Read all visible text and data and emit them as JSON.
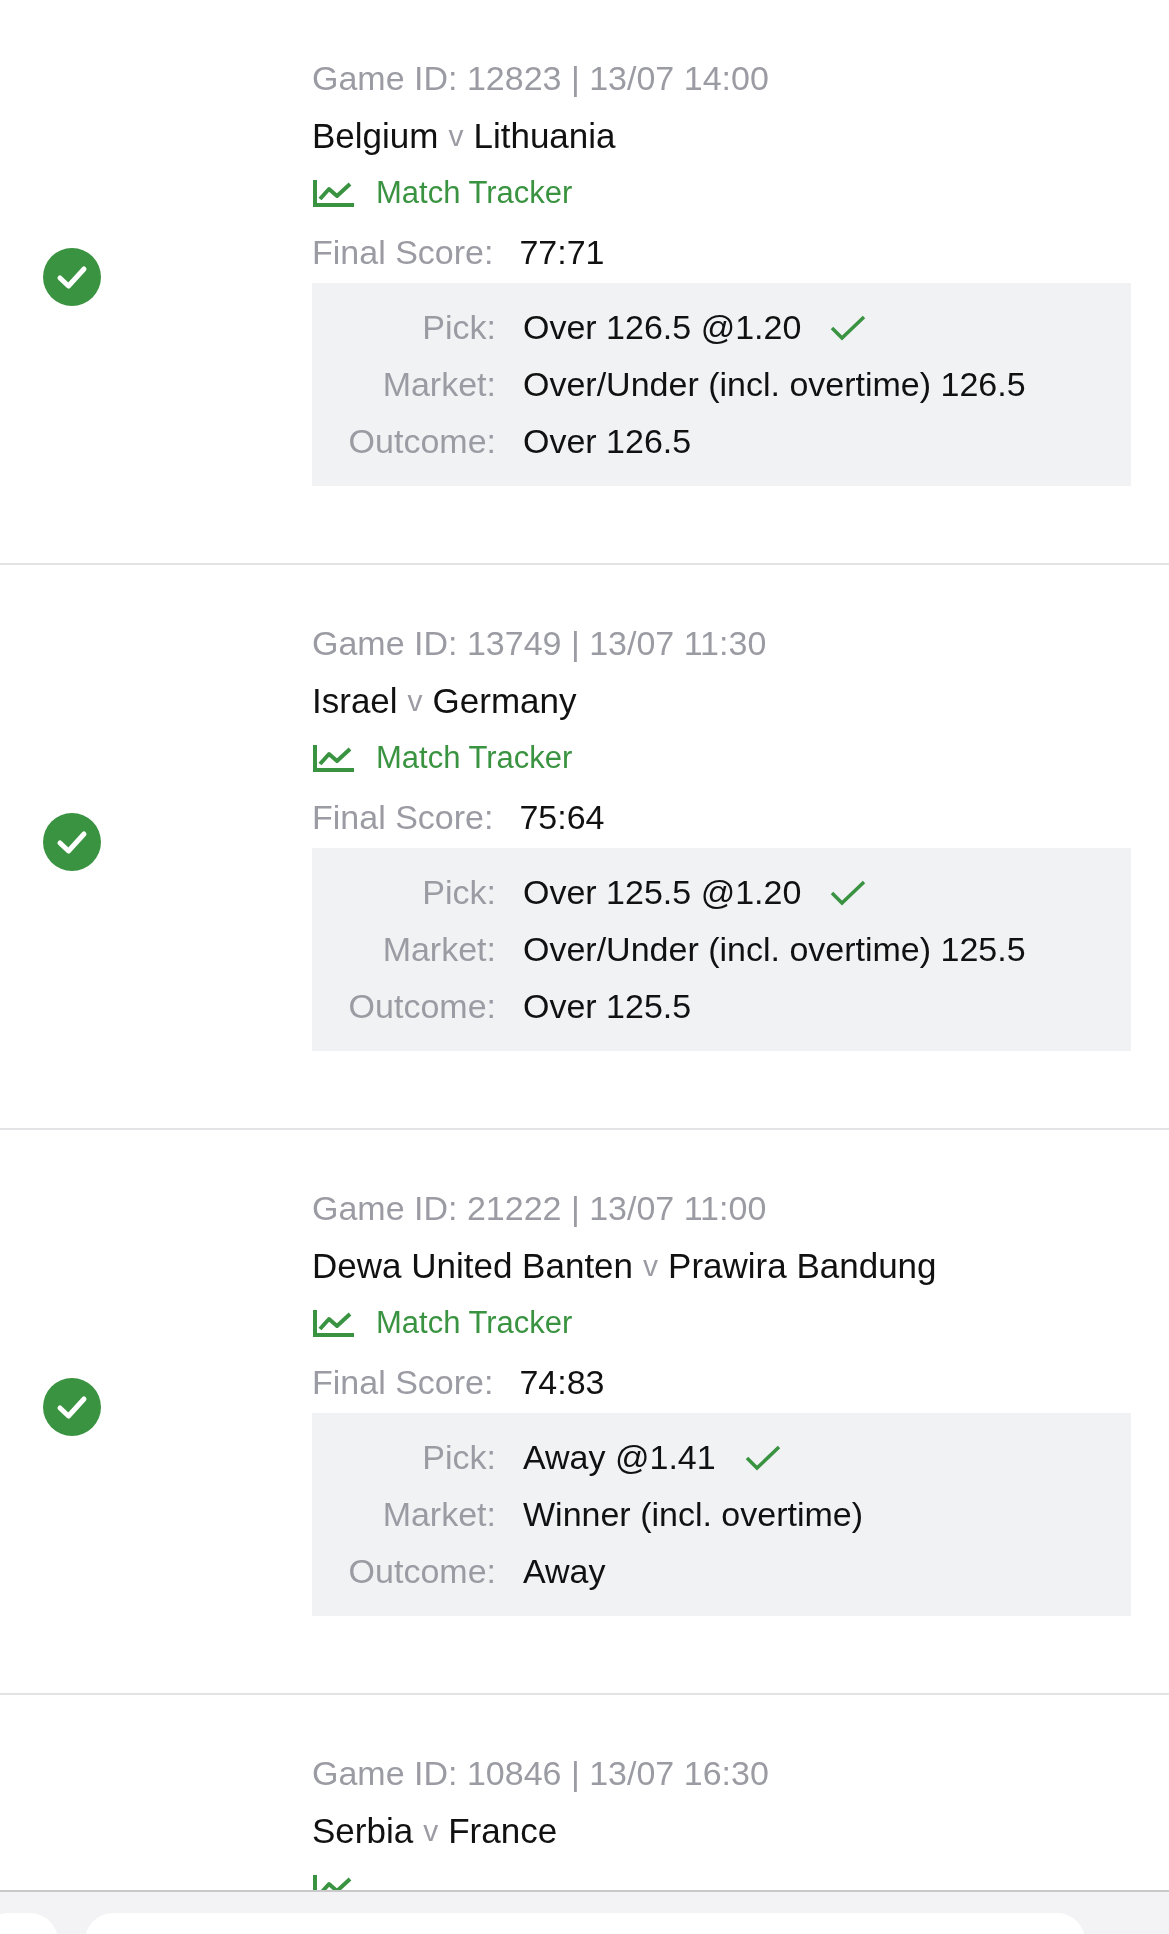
{
  "bets": [
    {
      "won": true,
      "game_id": "Game ID: 12823 | 13/07 14:00",
      "home": "Belgium",
      "separator": "v",
      "away": "Lithuania",
      "tracker": "Match Tracker",
      "score_label": "Final Score:",
      "score": "77:71",
      "details": [
        {
          "label": "Pick:",
          "value": "Over 126.5 @1.20",
          "correct": true
        },
        {
          "label": "Market:",
          "value": "Over/Under (incl. overtime) 126.5",
          "correct": false
        },
        {
          "label": "Outcome:",
          "value": "Over 126.5",
          "correct": false
        }
      ]
    },
    {
      "won": true,
      "game_id": "Game ID: 13749 | 13/07 11:30",
      "home": "Israel",
      "separator": "v",
      "away": "Germany",
      "tracker": "Match Tracker",
      "score_label": "Final Score:",
      "score": "75:64",
      "details": [
        {
          "label": "Pick:",
          "value": "Over 125.5 @1.20",
          "correct": true
        },
        {
          "label": "Market:",
          "value": "Over/Under (incl. overtime) 125.5",
          "correct": false
        },
        {
          "label": "Outcome:",
          "value": "Over 125.5",
          "correct": false
        }
      ]
    },
    {
      "won": true,
      "game_id": "Game ID: 21222 | 13/07 11:00",
      "home": "Dewa United Banten",
      "separator": "v",
      "away": "Prawira Bandung",
      "tracker": "Match Tracker",
      "score_label": "Final Score:",
      "score": "74:83",
      "details": [
        {
          "label": "Pick:",
          "value": "Away @1.41",
          "correct": true
        },
        {
          "label": "Market:",
          "value": "Winner (incl. overtime)",
          "correct": false
        },
        {
          "label": "Outcome:",
          "value": "Away",
          "correct": false
        }
      ]
    },
    {
      "game_id": "Game ID: 10846 | 13/07 16:30",
      "home": "Serbia",
      "separator": "v",
      "away": "France"
    }
  ]
}
